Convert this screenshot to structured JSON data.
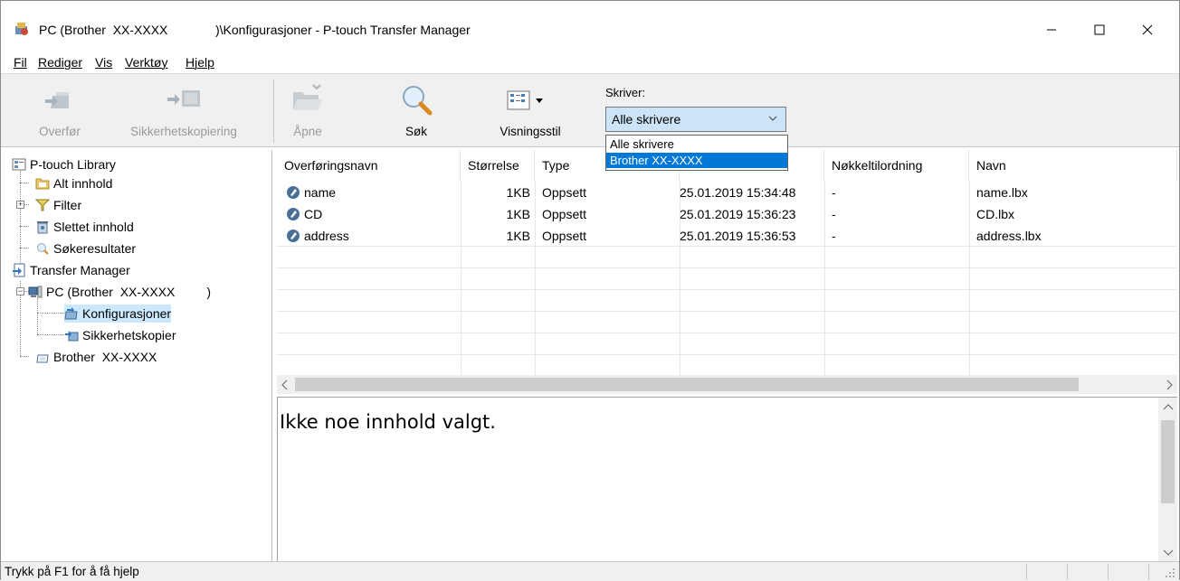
{
  "window": {
    "title_part1": "PC (Brother  XX-XXXX",
    "title_part2": ")\\Konfigurasjoner - P-touch Transfer Manager"
  },
  "menu": [
    {
      "label": "Fil",
      "name": "menu-fil"
    },
    {
      "label": "Rediger",
      "name": "menu-rediger"
    },
    {
      "label": "Vis",
      "name": "menu-vis"
    },
    {
      "label": "Verktøy",
      "name": "menu-verktoy"
    },
    {
      "label": "Hjelp",
      "name": "menu-hjelp"
    }
  ],
  "toolbar": {
    "transfer": "Overfør",
    "backup": "Sikkerhetskopiering",
    "open": "Åpne",
    "search": "Søk",
    "view_style": "Visningsstil",
    "printer_label": "Skriver:",
    "printer_selected": "Alle skrivere",
    "printer_options": [
      "Alle skrivere",
      "Brother  XX-XXXX"
    ]
  },
  "tree": {
    "library": "P-touch Library",
    "all_content": "Alt innhold",
    "filter": "Filter",
    "deleted": "Slettet innhold",
    "search_results": "Søkeresultater",
    "transfer_manager": "Transfer Manager",
    "pc": "PC (Brother  XX-XXXX         )",
    "configurations": "Konfigurasjoner",
    "backups": "Sikkerhetskopier",
    "printer": "Brother  XX-XXXX"
  },
  "list": {
    "columns": [
      "Overføringsnavn",
      "Størrelse",
      "Type",
      "",
      "Nøkkeltilordning",
      "Navn"
    ],
    "rows": [
      [
        "name",
        "1KB",
        "Oppsett",
        "25.01.2019 15:34:48",
        "-",
        "name.lbx"
      ],
      [
        "CD",
        "1KB",
        "Oppsett",
        "25.01.2019 15:36:23",
        "-",
        "CD.lbx"
      ],
      [
        "address",
        "1KB",
        "Oppsett",
        "25.01.2019 15:36:53",
        "-",
        "address.lbx"
      ]
    ]
  },
  "preview": {
    "text": "Ikke noe innhold valgt."
  },
  "status": {
    "text": "Trykk på F1 for å få hjelp"
  }
}
